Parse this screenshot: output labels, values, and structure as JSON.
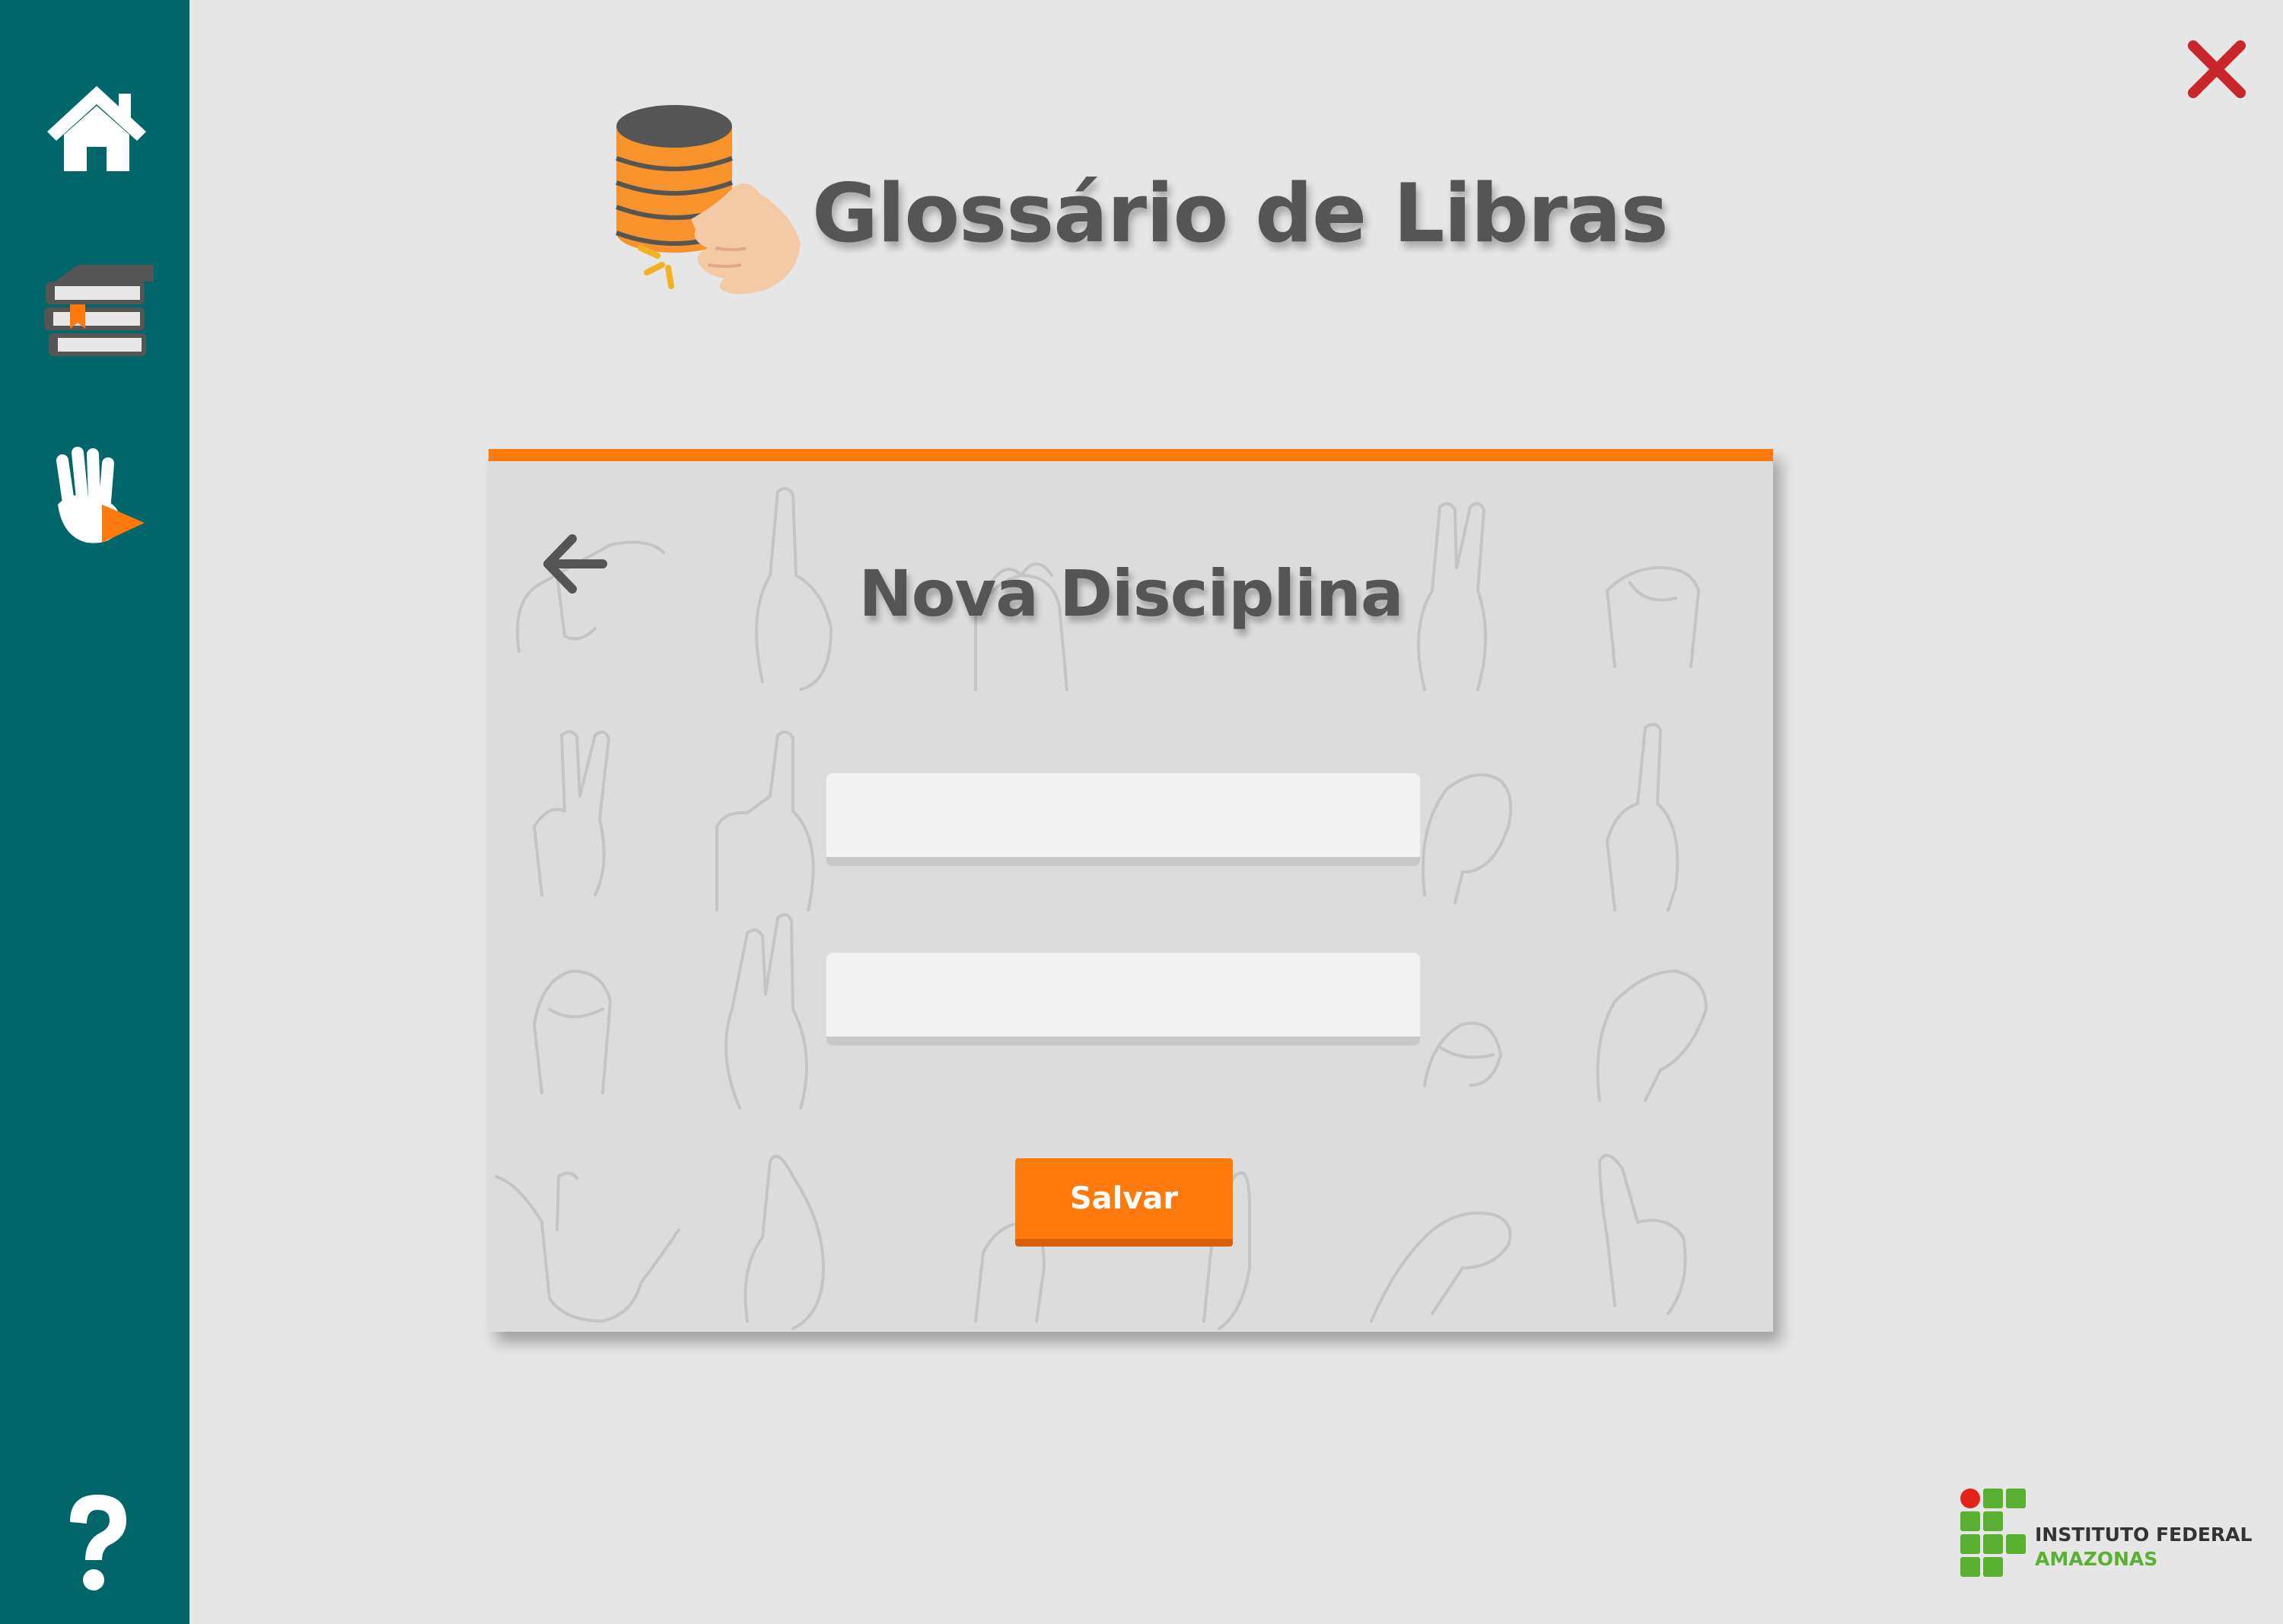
{
  "app": {
    "title": "Glossário de Libras"
  },
  "sidebar": {
    "items": [
      {
        "icon": "home-icon"
      },
      {
        "icon": "books-icon"
      },
      {
        "icon": "sign-video-icon"
      },
      {
        "icon": "help-icon"
      }
    ]
  },
  "window": {
    "close_icon": "close-icon"
  },
  "dialog": {
    "title": "Nova Disciplina",
    "back_icon": "arrow-left-icon",
    "fields": [
      {
        "value": "",
        "placeholder": ""
      },
      {
        "value": "",
        "placeholder": ""
      }
    ],
    "save_label": "Salvar"
  },
  "footer": {
    "logo_line_1": "INSTITUTO FEDERAL",
    "logo_line_2": "AMAZONAS"
  },
  "colors": {
    "sidebar": "#00666a",
    "accent": "#ff7a0d",
    "title_text": "#555555",
    "close": "#c8262c",
    "ifam_green": "#5ab031",
    "ifam_red": "#e2231a"
  }
}
